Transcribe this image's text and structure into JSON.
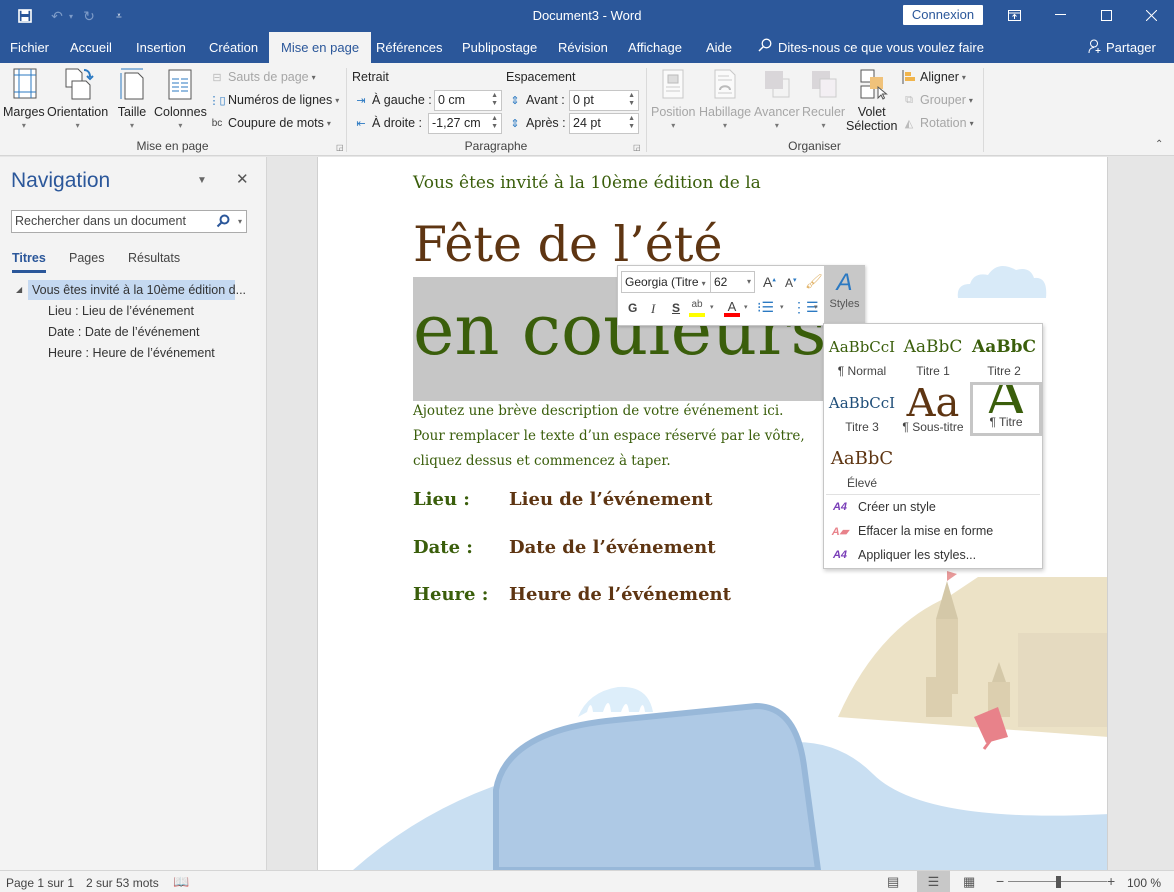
{
  "app": {
    "window_title": "Document3 - Word",
    "signin_label": "Connexion",
    "window_controls": [
      "ribbon-display-icon",
      "minimize-icon",
      "maximize-icon",
      "close-icon"
    ]
  },
  "qat": {
    "save": "save-icon",
    "undo": "undo-icon",
    "redo": "redo-icon",
    "customize": "customize-qat-icon"
  },
  "tabs": [
    {
      "label": "Fichier"
    },
    {
      "label": "Accueil"
    },
    {
      "label": "Insertion"
    },
    {
      "label": "Création"
    },
    {
      "label": "Mise en page",
      "active": true
    },
    {
      "label": "Références"
    },
    {
      "label": "Publipostage"
    },
    {
      "label": "Révision"
    },
    {
      "label": "Affichage"
    },
    {
      "label": "Aide"
    }
  ],
  "tellme": {
    "placeholder": "Dites-nous ce que vous voulez faire"
  },
  "share_label": "Partager",
  "ribbon": {
    "mise_en_page": {
      "label": "Mise en page",
      "buttons": [
        {
          "label": "Marges"
        },
        {
          "label": "Orientation"
        },
        {
          "label": "Taille"
        },
        {
          "label": "Colonnes"
        }
      ],
      "small": [
        {
          "label": "Sauts de page",
          "disabled": true
        },
        {
          "label": "Numéros de lignes"
        },
        {
          "label": "Coupure de mots"
        }
      ]
    },
    "paragraphe": {
      "label": "Paragraphe",
      "retrait_label": "Retrait",
      "espacement_label": "Espacement",
      "gauche_label": "À gauche :",
      "gauche_value": "0 cm",
      "droite_label": "À droite :",
      "droite_value": "-1,27 cm",
      "avant_label": "Avant :",
      "avant_value": "0 pt",
      "apres_label": "Après :",
      "apres_value": "24 pt"
    },
    "organiser": {
      "label": "Organiser",
      "buttons": [
        {
          "label": "Position",
          "disabled": true
        },
        {
          "label": "Habillage",
          "disabled": true
        },
        {
          "label": "Avancer",
          "disabled": true
        },
        {
          "label": "Reculer",
          "disabled": true
        }
      ],
      "volet_line1": "Volet",
      "volet_line2": "Sélection",
      "small": [
        {
          "label": "Aligner"
        },
        {
          "label": "Grouper",
          "disabled": true
        },
        {
          "label": "Rotation",
          "disabled": true
        }
      ]
    }
  },
  "nav": {
    "title": "Navigation",
    "search_placeholder": "Rechercher dans un document",
    "tabs": [
      {
        "label": "Titres",
        "active": true
      },
      {
        "label": "Pages"
      },
      {
        "label": "Résultats"
      }
    ],
    "tree": [
      {
        "label": "Vous êtes invité à la 10ème édition d...",
        "selected": true,
        "level": 1
      },
      {
        "label": "Lieu :  Lieu de l’événement",
        "level": 2
      },
      {
        "label": "Date :  Date de l’événement",
        "level": 2
      },
      {
        "label": "Heure :  Heure de l’événement",
        "level": 2
      }
    ]
  },
  "document": {
    "intro": "Vous êtes invité à la 10ème édition de la",
    "title1": "Fête de l’été",
    "title2": "en couleurs",
    "description": "Ajoutez une brève description de votre événement ici. Pour remplacer le texte d’un espace réservé par le vôtre, cliquez dessus et commencez à taper.",
    "details": [
      {
        "label": "Lieu :",
        "value": "Lieu de l’événement"
      },
      {
        "label": "Date :",
        "value": "Date de l’événement"
      },
      {
        "label": "Heure :",
        "value": "Heure de l’événement"
      }
    ],
    "colors": {
      "green": "#3a5e0b",
      "brown": "#5e3512",
      "selection": "#c6c6c6"
    }
  },
  "mini_toolbar": {
    "font": "Georgia (Titre",
    "size": "62",
    "bold": "G",
    "italic": "I",
    "underline": "S",
    "styles_label": "Styles",
    "highlight_color": "#ffff00",
    "font_color": "#ff0000"
  },
  "styles_gallery": {
    "items": [
      {
        "preview": "AaBbCcI",
        "label": "¶ Normal",
        "color": "#3a5e0b"
      },
      {
        "preview": "AaBbC",
        "label": "Titre 1",
        "color": "#3a5e0b"
      },
      {
        "preview": "AaBbC",
        "label": "Titre 2",
        "color": "#3a5e0b"
      },
      {
        "preview": "AaBbCcI",
        "label": "Titre 3",
        "color": "#1f4e79"
      },
      {
        "preview": "Aa",
        "label": "¶ Sous-titre",
        "color": "#5e3512"
      },
      {
        "preview": "A",
        "label": "¶ Titre",
        "color": "#3a5e0b",
        "selected": true
      },
      {
        "preview": "AaBbC",
        "label": "Élevé",
        "color": "#5e3512"
      }
    ],
    "menu": [
      {
        "label": "Créer un style",
        "icon": "create-style-icon"
      },
      {
        "label": "Effacer la mise en forme",
        "icon": "clear-formatting-icon"
      },
      {
        "label": "Appliquer les styles...",
        "icon": "apply-styles-icon"
      }
    ]
  },
  "status": {
    "page": "Page 1 sur 1",
    "words": "2 sur 53 mots",
    "zoom": "100 %",
    "zoom_fraction": 0.5
  }
}
